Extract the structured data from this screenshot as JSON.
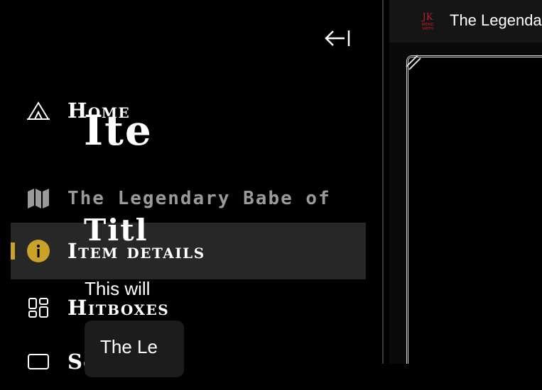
{
  "sidebar": {
    "collapse_icon": "collapse-left-icon",
    "items": [
      {
        "label": "Home",
        "icon": "tent-icon"
      },
      {
        "label": "The Legendary Babe of",
        "icon": "map-icon"
      },
      {
        "label": "Item details",
        "icon": "info-icon",
        "active": true
      },
      {
        "label": "Hitboxes",
        "icon": "grid-icon"
      },
      {
        "label": "Screens",
        "icon": "screen-icon"
      }
    ]
  },
  "header": {
    "logo_text": "JK WEIRD SMITH",
    "title": "The Legenda"
  },
  "main": {
    "page_title": "Ite",
    "section_title": "Titl",
    "description": "This will",
    "card_text": "The Le"
  },
  "colors": {
    "background": "#000000",
    "active_item": "#272727",
    "accent": "#c9a227",
    "dim_text": "#9a9a9a",
    "logo_red": "#c0202a"
  }
}
